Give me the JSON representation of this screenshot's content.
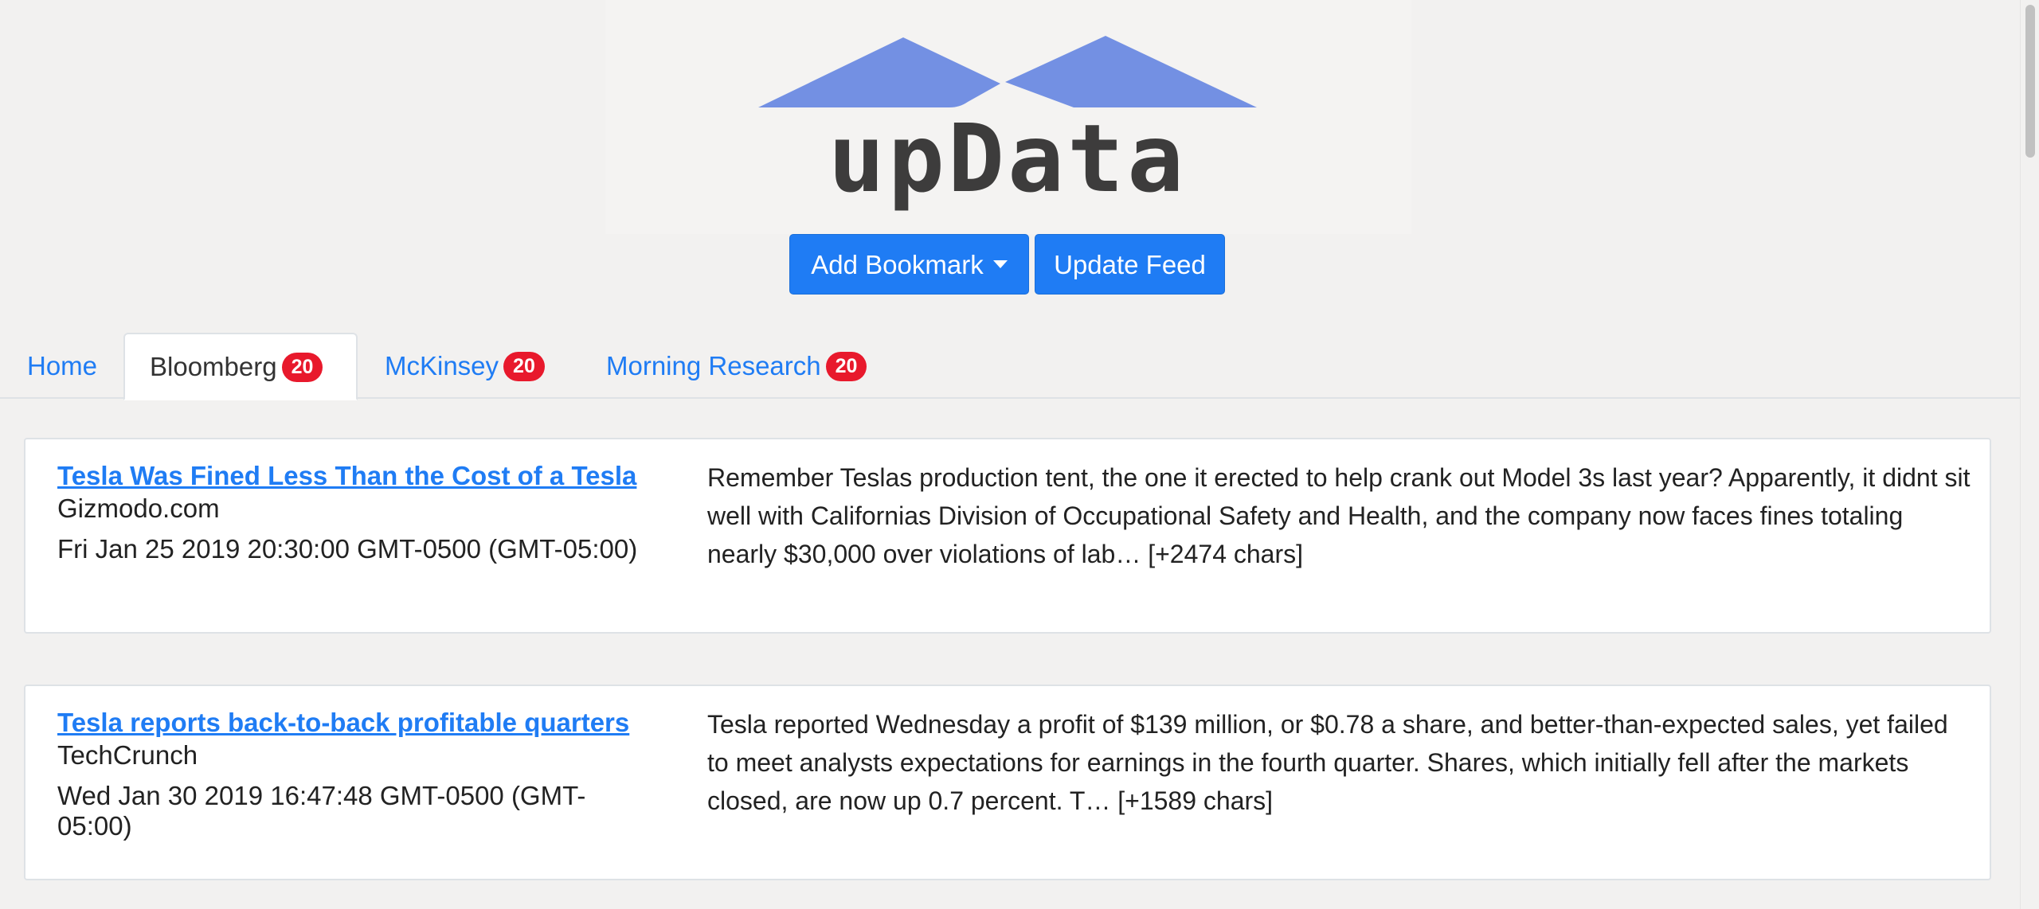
{
  "app": {
    "logo_text": "upData",
    "colors": {
      "brand_blue": "#1f7cf4",
      "logo_roof": "#7390e3",
      "logo_text": "#3d3c3c",
      "badge_red": "#e8192c"
    }
  },
  "toolbar": {
    "add_bookmark_label": "Add Bookmark",
    "update_feed_label": "Update Feed",
    "add_bookmark_icon": "caret-down-icon"
  },
  "tabs": [
    {
      "label": "Home",
      "badge": null,
      "active": false
    },
    {
      "label": "Bloomberg",
      "badge": "20",
      "active": true
    },
    {
      "label": "McKinsey",
      "badge": "20",
      "active": false
    },
    {
      "label": "Morning Research",
      "badge": "20",
      "active": false
    }
  ],
  "articles": [
    {
      "title": "Tesla Was Fined Less Than the Cost of a Tesla",
      "source": "Gizmodo.com",
      "date": "Fri Jan 25 2019 20:30:00 GMT-0500 (GMT-05:00)",
      "summary": "Remember Teslas production tent, the one it erected to help crank out Model 3s last year? Apparently, it didnt sit well with Californias Division of Occupational Safety and Health, and the company now faces fines totaling nearly $30,000 over violations of lab… [+2474 chars]"
    },
    {
      "title": "Tesla reports back-to-back profitable quarters",
      "source": "TechCrunch",
      "date": "Wed Jan 30 2019 16:47:48 GMT-0500 (GMT-05:00)",
      "summary": "Tesla reported Wednesday a profit of $139 million, or $0.78 a share, and better-than-expected sales, yet failed to meet analysts expectations for earnings in the fourth quarter. Shares, which initially fell after the markets closed, are now up 0.7 percent. T… [+1589 chars]"
    }
  ]
}
